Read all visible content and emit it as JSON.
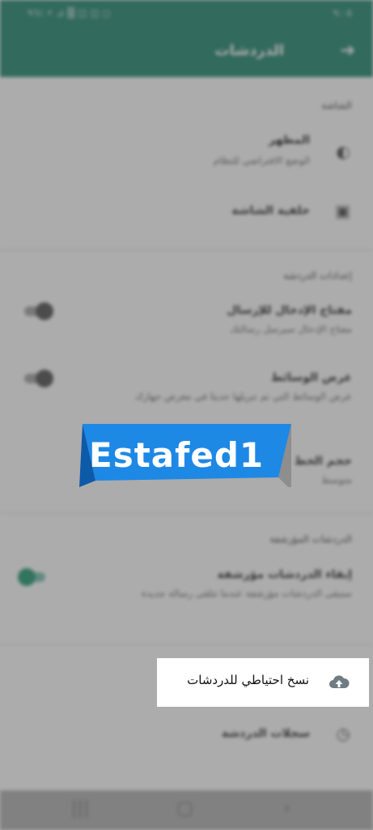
{
  "status_bar": {
    "left_text": "٩٦٪ ⚡ ⊿ ▒ ◫ ◫ ◻",
    "time": "٩:٠٥"
  },
  "app_bar": {
    "title": "الدردشات",
    "back_icon": "arrow-back-icon"
  },
  "sections": {
    "screen": {
      "header": "الشاشة",
      "theme": {
        "title": "المظهر",
        "subtitle": "الوضع الافتراضي للنظام",
        "icon": "theme-icon"
      },
      "wallpaper": {
        "title": "خلفية الشاشة",
        "icon": "wallpaper-icon"
      }
    },
    "chat_settings": {
      "header": "إعدادات الدردشة",
      "enter_key": {
        "title": "مفتاح الإدخال للإرسال",
        "subtitle": "مفتاح الإدخال سيرسل رسالتك",
        "enabled": false
      },
      "media_visibility": {
        "title": "عرض الوسائط",
        "subtitle": "عرض الوسائط التي تم تنزيلها حديثا في معرض جهازك",
        "enabled": false
      },
      "font_size": {
        "title": "حجم الخط",
        "subtitle": "متوسط"
      }
    },
    "archived": {
      "header": "الدردشات المؤرشفة",
      "keep_archived": {
        "title": "إبقاء الدردشات مؤرشفة",
        "subtitle": "ستبقى الدردشات مؤرشفة عندما تتلقى رسالة جديدة",
        "enabled": true
      }
    },
    "backup": {
      "title": "نسخ احتياطي للدردشات",
      "icon": "cloud-upload-icon"
    },
    "history": {
      "title": "سجلات الدردشة",
      "icon": "history-icon"
    }
  },
  "watermark": {
    "text": "Estafed1",
    "color": "#1e88e5"
  },
  "colors": {
    "app_bar": "#0b7a63",
    "accent": "#0a8f64"
  },
  "nav_bar": {
    "recents": "recents-icon",
    "home": "home-icon",
    "back": "back-icon"
  }
}
